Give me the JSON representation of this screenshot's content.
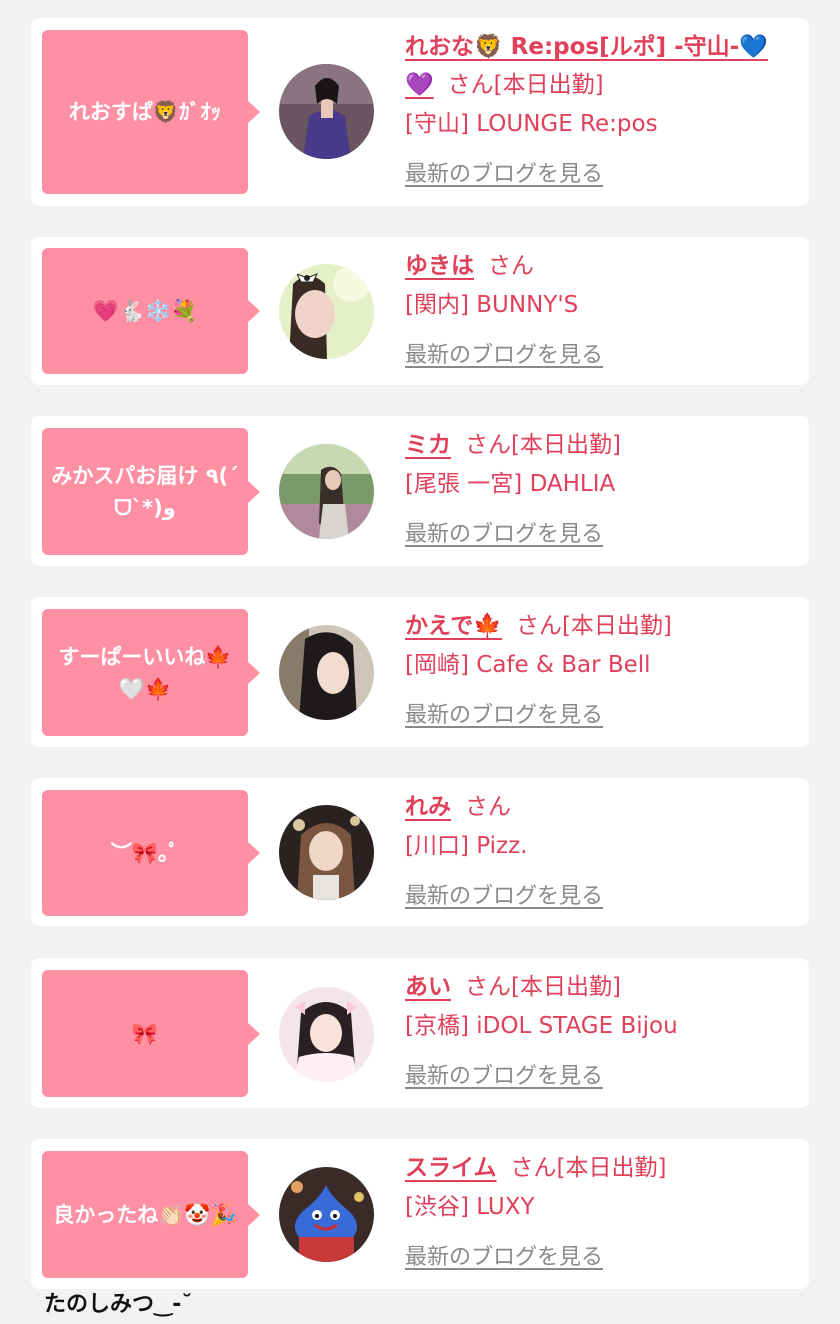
{
  "colors": {
    "page_bg": "#f2f2f2",
    "card_bg": "#ffffff",
    "bubble_bg": "#ff8fa3",
    "accent_pink": "#e0405a",
    "link_gray": "#8a8a8a"
  },
  "common": {
    "san": "さん",
    "blog_link": "最新のブログを見る"
  },
  "posts": [
    {
      "comment": "れおすぱ🦁ｶﾞｵｯ",
      "name": "れおな🦁 Re:pos[ルポ] -守山-💙💜",
      "status": "[本日出勤]",
      "shop": "[守山] LOUNGE Re:pos",
      "avatar_icon": "woman-in-purple-dress-photo"
    },
    {
      "comment": "💗🐇❄️💐",
      "name": "ゆきは",
      "status": "",
      "shop": "[関内] BUNNY'S",
      "avatar_icon": "woman-with-bow-photo"
    },
    {
      "comment": "みかスパお届け ٩(ˊᗜˋ*)و",
      "name": "ミカ",
      "status": "[本日出勤]",
      "shop": "[尾張 一宮] DAHLIA",
      "avatar_icon": "woman-long-hair-photo"
    },
    {
      "comment": "すーぱーいいね🍁🤍🍁",
      "name": "かえで🍁",
      "status": "[本日出勤]",
      "shop": "[岡崎] Cafe & Bar Bell",
      "avatar_icon": "woman-dark-hair-photo"
    },
    {
      "comment": "︶🎀｡ﾟ",
      "name": "れみ",
      "status": "",
      "shop": "[川口] Pizz.",
      "avatar_icon": "woman-smiling-photo"
    },
    {
      "comment": "🎀",
      "name": "あい",
      "status": "[本日出勤]",
      "shop": "[京橋] iDOL STAGE Bijou",
      "avatar_icon": "woman-with-ribbons-photo"
    },
    {
      "comment": "良かったね👏🏻🤡🎉",
      "name": "スライム",
      "status": "[本日出勤]",
      "shop": "[渋谷] LUXY",
      "avatar_icon": "slime-mask-photo"
    }
  ],
  "footer_text": "たのしみつ‿-˘"
}
